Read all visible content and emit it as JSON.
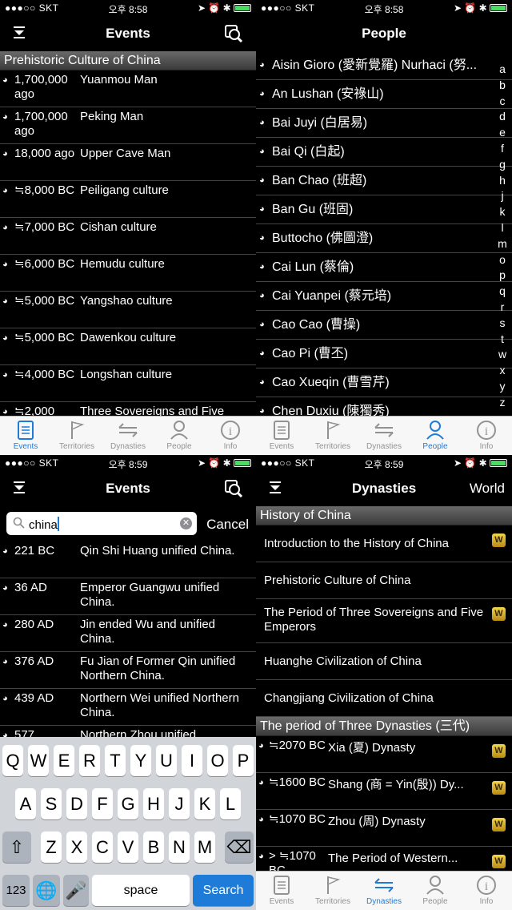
{
  "status": [
    {
      "carrier": "●●●○○ SKT",
      "time": "오후 8:58"
    },
    {
      "carrier": "●●●○○ SKT",
      "time": "오후 8:58"
    },
    {
      "carrier": "●●●○○ SKT",
      "time": "오후 8:59"
    },
    {
      "carrier": "●●●○○ SKT",
      "time": "오후 8:59"
    }
  ],
  "events_screen": {
    "title": "Events",
    "section": "Prehistoric Culture of China",
    "rows": [
      {
        "date": "1,700,000 ago",
        "name": "Yuanmou Man"
      },
      {
        "date": "1,700,000 ago",
        "name": "Peking Man"
      },
      {
        "date": "18,000 ago",
        "name": "Upper Cave Man"
      },
      {
        "date": "≒8,000 BC",
        "name": "Peiligang culture"
      },
      {
        "date": "≒7,000 BC",
        "name": "Cishan culture"
      },
      {
        "date": "≒6,000 BC",
        "name": "Hemudu culture"
      },
      {
        "date": "≒5,000 BC",
        "name": "Yangshao culture"
      },
      {
        "date": "≒5,000 BC",
        "name": "Dawenkou culture"
      },
      {
        "date": "≒4,000 BC",
        "name": "Longshan culture"
      },
      {
        "date": "≒2,000",
        "name": "Three Sovereigns and Five"
      }
    ]
  },
  "people_screen": {
    "title": "People",
    "rows": [
      "Aisin Gioro (愛新覺羅) Nurhaci (努...",
      "An Lushan (安祿山)",
      "Bai Juyi (白居易)",
      "Bai Qi (白起)",
      "Ban Chao (班超)",
      "Ban Gu (班固)",
      "Buttocho (佛圖澄)",
      "Cai Lun (蔡倫)",
      "Cai Yuanpei (蔡元培)",
      "Cao Cao (曹操)",
      "Cao Pi (曹丕)",
      "Cao Xueqin (曹雪芹)",
      "Chen Duxiu (陳獨秀)"
    ],
    "index": [
      "a",
      "b",
      "c",
      "d",
      "e",
      "f",
      "g",
      "h",
      "j",
      "k",
      "l",
      "m",
      "o",
      "p",
      "q",
      "r",
      "s",
      "t",
      "w",
      "x",
      "y",
      "z"
    ]
  },
  "search_screen": {
    "title": "Events",
    "query": "china",
    "cancel": "Cancel",
    "rows": [
      {
        "date": "221 BC",
        "name": "Qin Shi Huang unified China."
      },
      {
        "date": "36 AD",
        "name": "Emperor Guangwu unified China."
      },
      {
        "date": "280 AD",
        "name": "Jin ended Wu and unified China."
      },
      {
        "date": "376 AD",
        "name": "Fu Jian of Former Qin unified Northern China."
      },
      {
        "date": "439 AD",
        "name": "Northern Wei unified Northern China."
      },
      {
        "date": "577",
        "name": "Northern Zhou unified"
      }
    ],
    "keyboard": {
      "row1": [
        "Q",
        "W",
        "E",
        "R",
        "T",
        "Y",
        "U",
        "I",
        "O",
        "P"
      ],
      "row2": [
        "A",
        "S",
        "D",
        "F",
        "G",
        "H",
        "J",
        "K",
        "L"
      ],
      "row3": [
        "Z",
        "X",
        "C",
        "V",
        "B",
        "N",
        "M"
      ],
      "numbers": "123",
      "space": "space",
      "search": "Search"
    }
  },
  "dynasties_screen": {
    "title": "Dynasties",
    "right": "World",
    "section1": "History of China",
    "items": [
      {
        "name": "Introduction to the History of China",
        "w": true
      },
      {
        "name": "Prehistoric Culture of China",
        "w": false
      },
      {
        "name": "The Period of Three Sovereigns and Five Emperors",
        "w": true
      },
      {
        "name": "Huanghe Civilization of China",
        "w": false
      },
      {
        "name": "Changjiang Civilization of China",
        "w": false
      }
    ],
    "section2": "The period of Three Dynasties (三代)",
    "dynasties": [
      {
        "date": "≒2070 BC",
        "name": "Xia (夏) Dynasty"
      },
      {
        "date": "≒1600 BC",
        "name": "Shang (商 = Yin(殷)) Dy..."
      },
      {
        "date": "≒1070 BC",
        "name": "Zhou (周) Dynasty"
      },
      {
        "date": "> ≒1070 BC",
        "name": "The Period of Western..."
      }
    ],
    "w_label": "W"
  },
  "tabs": [
    "Events",
    "Territories",
    "Dynasties",
    "People",
    "Info"
  ],
  "colors": {
    "accent": "#1e7bd8",
    "battery": "#4cd964"
  }
}
